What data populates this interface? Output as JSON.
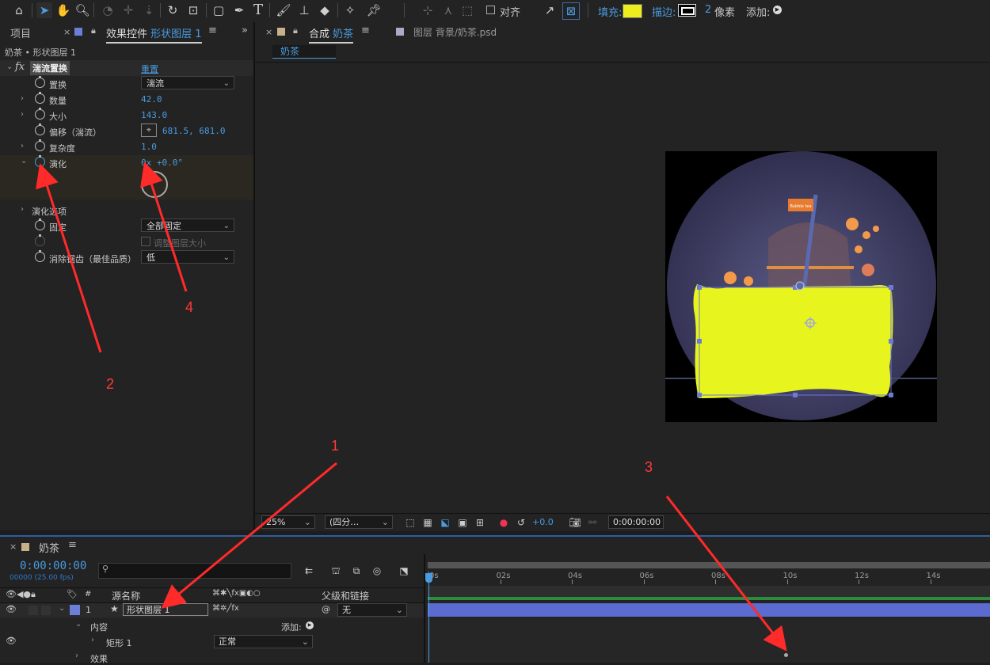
{
  "toolbar": {
    "align_label": "对齐",
    "fill_label": "填充:",
    "fill_color": "#ecee1d",
    "stroke_label": "描边:",
    "stroke_width": "2",
    "stroke_unit": "像素",
    "add_label": "添加:",
    "icons": [
      "home-icon",
      "selection-icon",
      "hand-icon",
      "zoom-icon",
      "orbit-icon",
      "pan-icon",
      "dolly-icon",
      "rotate-icon",
      "anchor-icon",
      "rectangle-icon",
      "pen-icon",
      "type-icon",
      "brush-icon",
      "clone-stamp-icon",
      "eraser-icon",
      "roto-brush-icon",
      "puppet-pin-icon"
    ]
  },
  "left_panel": {
    "tab_project": "项目",
    "tab_effects_prefix": "效果控件",
    "tab_effects_layer": "形状图层 1",
    "breadcrumb": "奶茶 • 形状图层 1",
    "effect_name": "湍流置换",
    "reset_label": "重置",
    "props": {
      "displace": {
        "label": "置换",
        "value": "湍流"
      },
      "amount": {
        "label": "数量",
        "value": "42.0"
      },
      "size": {
        "label": "大小",
        "value": "143.0"
      },
      "offset": {
        "label": "偏移（湍流）",
        "value": "681.5, 681.0"
      },
      "complexity": {
        "label": "复杂度",
        "value": "1.0"
      },
      "evolution": {
        "label": "演化",
        "value": "0x +0.0°"
      },
      "evo_options": {
        "label": "演化选项"
      },
      "pinning": {
        "label": "固定",
        "value": "全部固定"
      },
      "resize": {
        "label": "调整图层大小"
      },
      "antialias": {
        "label": "消除锯齿（最佳品质）",
        "value": "低"
      }
    }
  },
  "comp_panel": {
    "tab_comp_prefix": "合成",
    "tab_comp_name": "奶茶",
    "tab_layer": "图层 背景/奶茶.psd",
    "comp_chip": "奶茶",
    "artwork_flag_text": "Bubble tea",
    "zoom": "25%",
    "resolution": "(四分…",
    "exposure": "+0.0",
    "timecode": "0:00:00:00"
  },
  "timeline": {
    "tab_name": "奶茶",
    "timecode": "0:00:00:00",
    "frames": "00000 (25.00 fps)",
    "col_hash": "#",
    "col_source": "源名称",
    "col_parent": "父级和链接",
    "layer_num": "1",
    "layer_name": "形状图层 1",
    "parent_value": "无",
    "row_contents": "内容",
    "add_label": "添加:",
    "row_rect": "矩形 1",
    "blend_mode": "正常",
    "row_effects": "效果",
    "ruler": [
      "0s",
      "02s",
      "04s",
      "06s",
      "08s",
      "10s",
      "12s",
      "14s"
    ]
  },
  "annotations": {
    "a1": "1",
    "a2": "2",
    "a3": "3",
    "a4": "4"
  }
}
